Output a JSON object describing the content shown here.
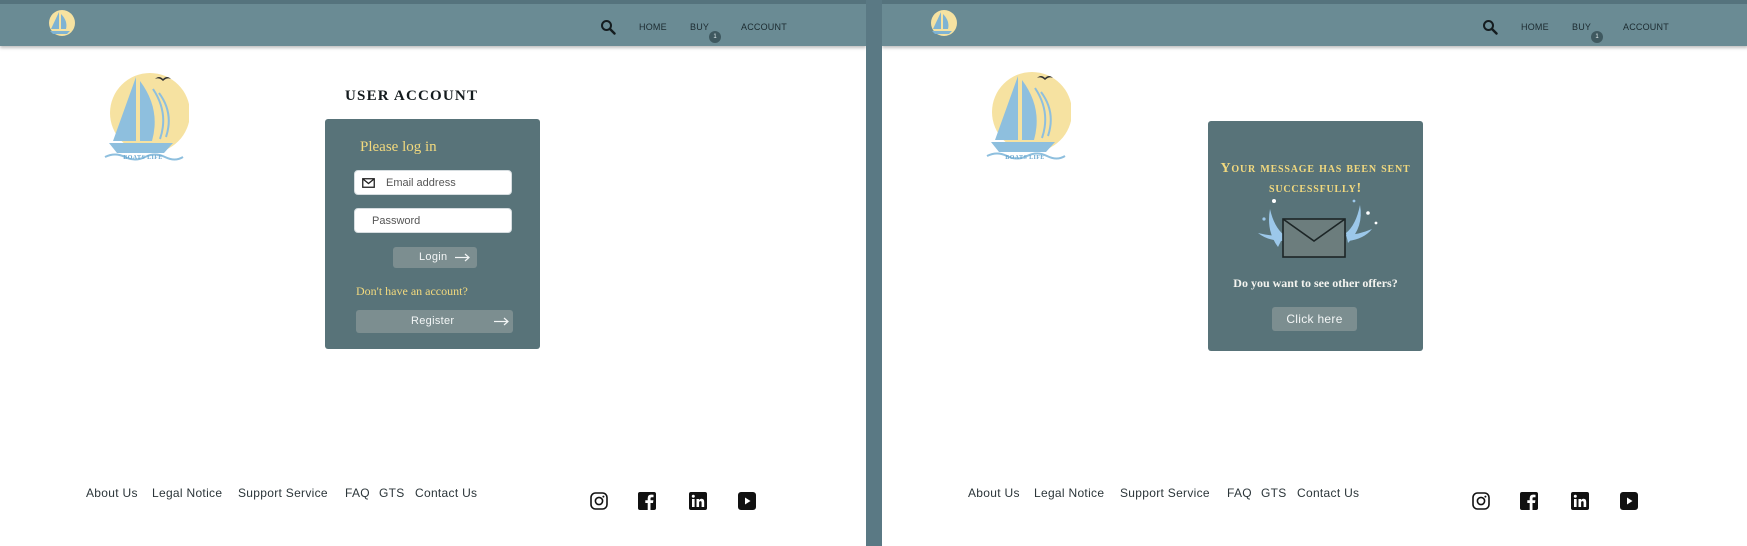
{
  "nav": {
    "home": "HOME",
    "buy": "BUY",
    "cart_count": "1",
    "account": "ACCOUNT"
  },
  "logo": {
    "caption": "BOATS LIFE"
  },
  "login_page": {
    "title": "USER ACCOUNT",
    "heading": "Please log in",
    "email_placeholder": "Email address",
    "password_placeholder": "Password",
    "login_label": "Login",
    "signup_question": "Don't have an account?",
    "register_label": "Register"
  },
  "message_page": {
    "title": "Your message has been sent successfully!",
    "question": "Do you want to see other offers?",
    "button_label": "Click here"
  },
  "footer": {
    "links": [
      "About Us",
      "Legal Notice",
      "Support Service",
      "FAQ",
      "GTS",
      "Contact Us"
    ],
    "social": [
      "instagram-icon",
      "facebook-icon",
      "linkedin-icon",
      "youtube-icon"
    ]
  },
  "colors": {
    "header": "#6a8b94",
    "card": "#587379",
    "accent_gold": "#f2d97e",
    "button": "#7c8e90",
    "divider": "#5a7984"
  }
}
